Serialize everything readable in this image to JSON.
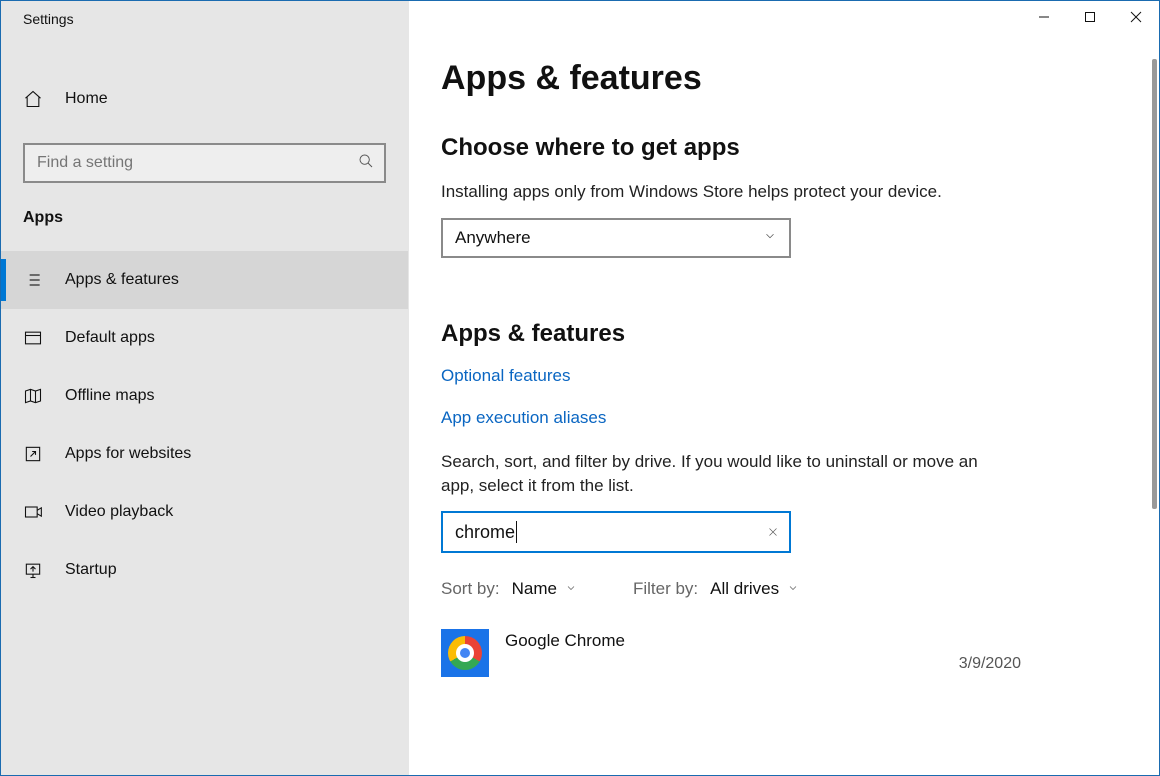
{
  "window": {
    "title": "Settings"
  },
  "sidebar": {
    "home": "Home",
    "search_placeholder": "Find a setting",
    "section": "Apps",
    "items": [
      {
        "label": "Apps & features",
        "icon": "list",
        "active": true
      },
      {
        "label": "Default apps",
        "icon": "defaults"
      },
      {
        "label": "Offline maps",
        "icon": "map"
      },
      {
        "label": "Apps for websites",
        "icon": "launch"
      },
      {
        "label": "Video playback",
        "icon": "video"
      },
      {
        "label": "Startup",
        "icon": "startup"
      }
    ]
  },
  "main": {
    "title": "Apps & features",
    "choose_section": {
      "heading": "Choose where to get apps",
      "description": "Installing apps only from Windows Store helps protect your device.",
      "selected": "Anywhere"
    },
    "apps_section": {
      "heading": "Apps & features",
      "links": {
        "optional": "Optional features",
        "aliases": "App execution aliases"
      },
      "description": "Search, sort, and filter by drive. If you would like to uninstall or move an app, select it from the list.",
      "search_value": "chrome",
      "sort_label": "Sort by:",
      "sort_value": "Name",
      "filter_label": "Filter by:",
      "filter_value": "All drives",
      "results": [
        {
          "name": "Google Chrome",
          "date": "3/9/2020"
        }
      ]
    }
  }
}
